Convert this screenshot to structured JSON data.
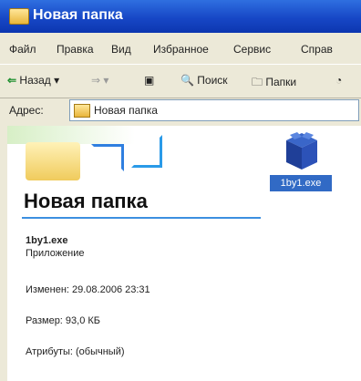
{
  "window": {
    "title": "Новая папка"
  },
  "menu": [
    "Файл",
    "Правка",
    "Вид",
    "Избранное",
    "Сервис",
    "Справ"
  ],
  "toolbar": {
    "back": "Назад",
    "search": "Поиск",
    "folders": "Папки"
  },
  "address": {
    "label": "Адрес:",
    "value": "Новая папка"
  },
  "panel": {
    "heading": "Новая папка",
    "file_label": "1by1.exe",
    "file_name": "1by1.exe",
    "file_type": "Приложение",
    "modified": "Изменен: 29.08.2006 23:31",
    "size": "Размер: 93,0 КБ",
    "attributes": "Атрибуты: (обычный)"
  },
  "colors": {
    "title": "#1747c6",
    "selection": "#316ac5",
    "rule": "#3c8fe0"
  }
}
